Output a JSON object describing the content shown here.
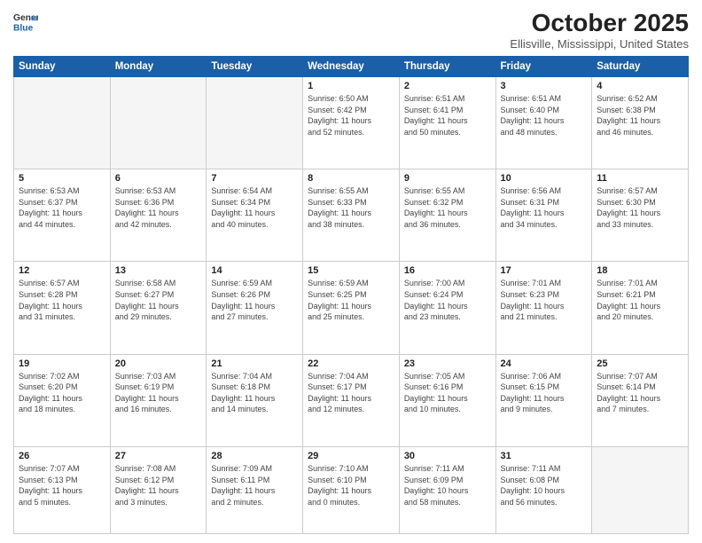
{
  "header": {
    "logo_line1": "General",
    "logo_line2": "Blue",
    "month": "October 2025",
    "location": "Ellisville, Mississippi, United States"
  },
  "weekdays": [
    "Sunday",
    "Monday",
    "Tuesday",
    "Wednesday",
    "Thursday",
    "Friday",
    "Saturday"
  ],
  "weeks": [
    [
      {
        "day": "",
        "info": ""
      },
      {
        "day": "",
        "info": ""
      },
      {
        "day": "",
        "info": ""
      },
      {
        "day": "1",
        "info": "Sunrise: 6:50 AM\nSunset: 6:42 PM\nDaylight: 11 hours\nand 52 minutes."
      },
      {
        "day": "2",
        "info": "Sunrise: 6:51 AM\nSunset: 6:41 PM\nDaylight: 11 hours\nand 50 minutes."
      },
      {
        "day": "3",
        "info": "Sunrise: 6:51 AM\nSunset: 6:40 PM\nDaylight: 11 hours\nand 48 minutes."
      },
      {
        "day": "4",
        "info": "Sunrise: 6:52 AM\nSunset: 6:38 PM\nDaylight: 11 hours\nand 46 minutes."
      }
    ],
    [
      {
        "day": "5",
        "info": "Sunrise: 6:53 AM\nSunset: 6:37 PM\nDaylight: 11 hours\nand 44 minutes."
      },
      {
        "day": "6",
        "info": "Sunrise: 6:53 AM\nSunset: 6:36 PM\nDaylight: 11 hours\nand 42 minutes."
      },
      {
        "day": "7",
        "info": "Sunrise: 6:54 AM\nSunset: 6:34 PM\nDaylight: 11 hours\nand 40 minutes."
      },
      {
        "day": "8",
        "info": "Sunrise: 6:55 AM\nSunset: 6:33 PM\nDaylight: 11 hours\nand 38 minutes."
      },
      {
        "day": "9",
        "info": "Sunrise: 6:55 AM\nSunset: 6:32 PM\nDaylight: 11 hours\nand 36 minutes."
      },
      {
        "day": "10",
        "info": "Sunrise: 6:56 AM\nSunset: 6:31 PM\nDaylight: 11 hours\nand 34 minutes."
      },
      {
        "day": "11",
        "info": "Sunrise: 6:57 AM\nSunset: 6:30 PM\nDaylight: 11 hours\nand 33 minutes."
      }
    ],
    [
      {
        "day": "12",
        "info": "Sunrise: 6:57 AM\nSunset: 6:28 PM\nDaylight: 11 hours\nand 31 minutes."
      },
      {
        "day": "13",
        "info": "Sunrise: 6:58 AM\nSunset: 6:27 PM\nDaylight: 11 hours\nand 29 minutes."
      },
      {
        "day": "14",
        "info": "Sunrise: 6:59 AM\nSunset: 6:26 PM\nDaylight: 11 hours\nand 27 minutes."
      },
      {
        "day": "15",
        "info": "Sunrise: 6:59 AM\nSunset: 6:25 PM\nDaylight: 11 hours\nand 25 minutes."
      },
      {
        "day": "16",
        "info": "Sunrise: 7:00 AM\nSunset: 6:24 PM\nDaylight: 11 hours\nand 23 minutes."
      },
      {
        "day": "17",
        "info": "Sunrise: 7:01 AM\nSunset: 6:23 PM\nDaylight: 11 hours\nand 21 minutes."
      },
      {
        "day": "18",
        "info": "Sunrise: 7:01 AM\nSunset: 6:21 PM\nDaylight: 11 hours\nand 20 minutes."
      }
    ],
    [
      {
        "day": "19",
        "info": "Sunrise: 7:02 AM\nSunset: 6:20 PM\nDaylight: 11 hours\nand 18 minutes."
      },
      {
        "day": "20",
        "info": "Sunrise: 7:03 AM\nSunset: 6:19 PM\nDaylight: 11 hours\nand 16 minutes."
      },
      {
        "day": "21",
        "info": "Sunrise: 7:04 AM\nSunset: 6:18 PM\nDaylight: 11 hours\nand 14 minutes."
      },
      {
        "day": "22",
        "info": "Sunrise: 7:04 AM\nSunset: 6:17 PM\nDaylight: 11 hours\nand 12 minutes."
      },
      {
        "day": "23",
        "info": "Sunrise: 7:05 AM\nSunset: 6:16 PM\nDaylight: 11 hours\nand 10 minutes."
      },
      {
        "day": "24",
        "info": "Sunrise: 7:06 AM\nSunset: 6:15 PM\nDaylight: 11 hours\nand 9 minutes."
      },
      {
        "day": "25",
        "info": "Sunrise: 7:07 AM\nSunset: 6:14 PM\nDaylight: 11 hours\nand 7 minutes."
      }
    ],
    [
      {
        "day": "26",
        "info": "Sunrise: 7:07 AM\nSunset: 6:13 PM\nDaylight: 11 hours\nand 5 minutes."
      },
      {
        "day": "27",
        "info": "Sunrise: 7:08 AM\nSunset: 6:12 PM\nDaylight: 11 hours\nand 3 minutes."
      },
      {
        "day": "28",
        "info": "Sunrise: 7:09 AM\nSunset: 6:11 PM\nDaylight: 11 hours\nand 2 minutes."
      },
      {
        "day": "29",
        "info": "Sunrise: 7:10 AM\nSunset: 6:10 PM\nDaylight: 11 hours\nand 0 minutes."
      },
      {
        "day": "30",
        "info": "Sunrise: 7:11 AM\nSunset: 6:09 PM\nDaylight: 10 hours\nand 58 minutes."
      },
      {
        "day": "31",
        "info": "Sunrise: 7:11 AM\nSunset: 6:08 PM\nDaylight: 10 hours\nand 56 minutes."
      },
      {
        "day": "",
        "info": ""
      }
    ]
  ]
}
